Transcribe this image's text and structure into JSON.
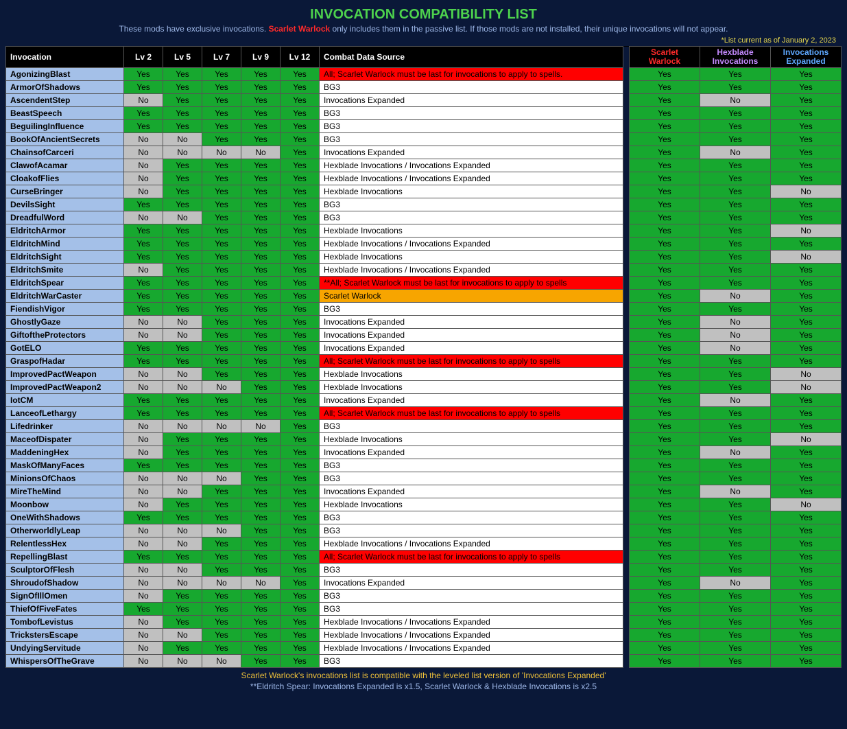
{
  "header": {
    "title": "INVOCATION COMPATIBILITY LIST",
    "subtitle_pre": "These mods have exclusive invocations. ",
    "subtitle_mod": "Scarlet Warlock",
    "subtitle_post": " only includes them in the passive list. If those mods are not installed, their unique invocations will not appear.",
    "asof": "*List current as of January 2, 2023"
  },
  "columns": {
    "name": "Invocation",
    "lv2": "Lv 2",
    "lv5": "Lv 5",
    "lv7": "Lv 7",
    "lv9": "Lv 9",
    "lv12": "Lv 12",
    "src": "Combat Data Source",
    "sw1": "Scarlet",
    "sw2": "Warlock",
    "hb1": "Hexblade",
    "hb2": "Invocations",
    "ie1": "Invocations",
    "ie2": "Expanded"
  },
  "rows": [
    {
      "name": "AgonizingBlast",
      "lv": [
        "Yes",
        "Yes",
        "Yes",
        "Yes",
        "Yes"
      ],
      "src": "All; Scarlet Warlock must be last for invocations to apply to spells.",
      "srcStyle": "red",
      "sw": "Yes",
      "hb": "Yes",
      "ie": "Yes"
    },
    {
      "name": "ArmorOfShadows",
      "lv": [
        "Yes",
        "Yes",
        "Yes",
        "Yes",
        "Yes"
      ],
      "src": "BG3",
      "srcStyle": "",
      "sw": "Yes",
      "hb": "Yes",
      "ie": "Yes"
    },
    {
      "name": "AscendentStep",
      "lv": [
        "No",
        "Yes",
        "Yes",
        "Yes",
        "Yes"
      ],
      "src": "Invocations Expanded",
      "srcStyle": "",
      "sw": "Yes",
      "hb": "No",
      "ie": "Yes"
    },
    {
      "name": "BeastSpeech",
      "lv": [
        "Yes",
        "Yes",
        "Yes",
        "Yes",
        "Yes"
      ],
      "src": "BG3",
      "srcStyle": "",
      "sw": "Yes",
      "hb": "Yes",
      "ie": "Yes"
    },
    {
      "name": "BeguilingInfluence",
      "lv": [
        "Yes",
        "Yes",
        "Yes",
        "Yes",
        "Yes"
      ],
      "src": "BG3",
      "srcStyle": "",
      "sw": "Yes",
      "hb": "Yes",
      "ie": "Yes"
    },
    {
      "name": "BookOfAncientSecrets",
      "lv": [
        "No",
        "No",
        "Yes",
        "Yes",
        "Yes"
      ],
      "src": "BG3",
      "srcStyle": "",
      "sw": "Yes",
      "hb": "Yes",
      "ie": "Yes"
    },
    {
      "name": "ChainsofCarceri",
      "lv": [
        "No",
        "No",
        "No",
        "No",
        "Yes"
      ],
      "src": "Invocations Expanded",
      "srcStyle": "",
      "sw": "Yes",
      "hb": "No",
      "ie": "Yes"
    },
    {
      "name": "ClawofAcamar",
      "lv": [
        "No",
        "Yes",
        "Yes",
        "Yes",
        "Yes"
      ],
      "src": "Hexblade Invocations / Invocations Expanded",
      "srcStyle": "",
      "sw": "Yes",
      "hb": "Yes",
      "ie": "Yes"
    },
    {
      "name": "CloakofFlies",
      "lv": [
        "No",
        "Yes",
        "Yes",
        "Yes",
        "Yes"
      ],
      "src": "Hexblade Invocations / Invocations Expanded",
      "srcStyle": "",
      "sw": "Yes",
      "hb": "Yes",
      "ie": "Yes"
    },
    {
      "name": "CurseBringer",
      "lv": [
        "No",
        "Yes",
        "Yes",
        "Yes",
        "Yes"
      ],
      "src": "Hexblade Invocations",
      "srcStyle": "",
      "sw": "Yes",
      "hb": "Yes",
      "ie": "No"
    },
    {
      "name": "DevilsSight",
      "lv": [
        "Yes",
        "Yes",
        "Yes",
        "Yes",
        "Yes"
      ],
      "src": "BG3",
      "srcStyle": "",
      "sw": "Yes",
      "hb": "Yes",
      "ie": "Yes"
    },
    {
      "name": "DreadfulWord",
      "lv": [
        "No",
        "No",
        "Yes",
        "Yes",
        "Yes"
      ],
      "src": "BG3",
      "srcStyle": "",
      "sw": "Yes",
      "hb": "Yes",
      "ie": "Yes"
    },
    {
      "name": "EldritchArmor",
      "lv": [
        "Yes",
        "Yes",
        "Yes",
        "Yes",
        "Yes"
      ],
      "src": "Hexblade Invocations",
      "srcStyle": "",
      "sw": "Yes",
      "hb": "Yes",
      "ie": "No"
    },
    {
      "name": "EldritchMind",
      "lv": [
        "Yes",
        "Yes",
        "Yes",
        "Yes",
        "Yes"
      ],
      "src": "Hexblade Invocations / Invocations Expanded",
      "srcStyle": "",
      "sw": "Yes",
      "hb": "Yes",
      "ie": "Yes"
    },
    {
      "name": "EldritchSight",
      "lv": [
        "Yes",
        "Yes",
        "Yes",
        "Yes",
        "Yes"
      ],
      "src": "Hexblade Invocations",
      "srcStyle": "",
      "sw": "Yes",
      "hb": "Yes",
      "ie": "No"
    },
    {
      "name": "EldritchSmite",
      "lv": [
        "No",
        "Yes",
        "Yes",
        "Yes",
        "Yes"
      ],
      "src": "Hexblade Invocations / Invocations Expanded",
      "srcStyle": "",
      "sw": "Yes",
      "hb": "Yes",
      "ie": "Yes"
    },
    {
      "name": "EldritchSpear",
      "lv": [
        "Yes",
        "Yes",
        "Yes",
        "Yes",
        "Yes"
      ],
      "src": "**All; Scarlet Warlock must be last for invocations to apply to spells",
      "srcStyle": "red",
      "sw": "Yes",
      "hb": "Yes",
      "ie": "Yes"
    },
    {
      "name": "EldritchWarCaster",
      "lv": [
        "Yes",
        "Yes",
        "Yes",
        "Yes",
        "Yes"
      ],
      "src": "Scarlet Warlock",
      "srcStyle": "orange",
      "sw": "Yes",
      "hb": "No",
      "ie": "Yes"
    },
    {
      "name": "FiendishVigor",
      "lv": [
        "Yes",
        "Yes",
        "Yes",
        "Yes",
        "Yes"
      ],
      "src": "BG3",
      "srcStyle": "",
      "sw": "Yes",
      "hb": "Yes",
      "ie": "Yes"
    },
    {
      "name": "GhostlyGaze",
      "lv": [
        "No",
        "No",
        "Yes",
        "Yes",
        "Yes"
      ],
      "src": "Invocations Expanded",
      "srcStyle": "",
      "sw": "Yes",
      "hb": "No",
      "ie": "Yes"
    },
    {
      "name": "GiftoftheProtectors",
      "lv": [
        "No",
        "No",
        "Yes",
        "Yes",
        "Yes"
      ],
      "src": "Invocations Expanded",
      "srcStyle": "",
      "sw": "Yes",
      "hb": "No",
      "ie": "Yes"
    },
    {
      "name": "GotELO",
      "lv": [
        "Yes",
        "Yes",
        "Yes",
        "Yes",
        "Yes"
      ],
      "src": "Invocations Expanded",
      "srcStyle": "",
      "sw": "Yes",
      "hb": "No",
      "ie": "Yes"
    },
    {
      "name": "GraspofHadar",
      "lv": [
        "Yes",
        "Yes",
        "Yes",
        "Yes",
        "Yes"
      ],
      "src": "All; Scarlet Warlock must be last for invocations to apply to spells",
      "srcStyle": "red",
      "sw": "Yes",
      "hb": "Yes",
      "ie": "Yes"
    },
    {
      "name": "ImprovedPactWeapon",
      "lv": [
        "No",
        "No",
        "Yes",
        "Yes",
        "Yes"
      ],
      "src": "Hexblade Invocations",
      "srcStyle": "",
      "sw": "Yes",
      "hb": "Yes",
      "ie": "No"
    },
    {
      "name": "ImprovedPactWeapon2",
      "lv": [
        "No",
        "No",
        "No",
        "Yes",
        "Yes"
      ],
      "src": "Hexblade Invocations",
      "srcStyle": "",
      "sw": "Yes",
      "hb": "Yes",
      "ie": "No"
    },
    {
      "name": "IotCM",
      "lv": [
        "Yes",
        "Yes",
        "Yes",
        "Yes",
        "Yes"
      ],
      "src": "Invocations Expanded",
      "srcStyle": "",
      "sw": "Yes",
      "hb": "No",
      "ie": "Yes"
    },
    {
      "name": "LanceofLethargy",
      "lv": [
        "Yes",
        "Yes",
        "Yes",
        "Yes",
        "Yes"
      ],
      "src": "All; Scarlet Warlock must be last for invocations to apply to spells",
      "srcStyle": "red",
      "sw": "Yes",
      "hb": "Yes",
      "ie": "Yes"
    },
    {
      "name": "Lifedrinker",
      "lv": [
        "No",
        "No",
        "No",
        "No",
        "Yes"
      ],
      "src": "BG3",
      "srcStyle": "",
      "sw": "Yes",
      "hb": "Yes",
      "ie": "Yes"
    },
    {
      "name": "MaceofDispater",
      "lv": [
        "No",
        "Yes",
        "Yes",
        "Yes",
        "Yes"
      ],
      "src": "Hexblade Invocations",
      "srcStyle": "",
      "sw": "Yes",
      "hb": "Yes",
      "ie": "No"
    },
    {
      "name": "MaddeningHex",
      "lv": [
        "No",
        "Yes",
        "Yes",
        "Yes",
        "Yes"
      ],
      "src": "Invocations Expanded",
      "srcStyle": "",
      "sw": "Yes",
      "hb": "No",
      "ie": "Yes"
    },
    {
      "name": "MaskOfManyFaces",
      "lv": [
        "Yes",
        "Yes",
        "Yes",
        "Yes",
        "Yes"
      ],
      "src": "BG3",
      "srcStyle": "",
      "sw": "Yes",
      "hb": "Yes",
      "ie": "Yes"
    },
    {
      "name": "MinionsOfChaos",
      "lv": [
        "No",
        "No",
        "No",
        "Yes",
        "Yes"
      ],
      "src": "BG3",
      "srcStyle": "",
      "sw": "Yes",
      "hb": "Yes",
      "ie": "Yes"
    },
    {
      "name": "MireTheMind",
      "lv": [
        "No",
        "No",
        "Yes",
        "Yes",
        "Yes"
      ],
      "src": "Invocations Expanded",
      "srcStyle": "",
      "sw": "Yes",
      "hb": "No",
      "ie": "Yes"
    },
    {
      "name": "Moonbow",
      "lv": [
        "No",
        "Yes",
        "Yes",
        "Yes",
        "Yes"
      ],
      "src": "Hexblade Invocations",
      "srcStyle": "",
      "sw": "Yes",
      "hb": "Yes",
      "ie": "No"
    },
    {
      "name": "OneWithShadows",
      "lv": [
        "Yes",
        "Yes",
        "Yes",
        "Yes",
        "Yes"
      ],
      "src": "BG3",
      "srcStyle": "",
      "sw": "Yes",
      "hb": "Yes",
      "ie": "Yes"
    },
    {
      "name": "OtherworldlyLeap",
      "lv": [
        "No",
        "No",
        "No",
        "Yes",
        "Yes"
      ],
      "src": "BG3",
      "srcStyle": "",
      "sw": "Yes",
      "hb": "Yes",
      "ie": "Yes"
    },
    {
      "name": "RelentlessHex",
      "lv": [
        "No",
        "No",
        "Yes",
        "Yes",
        "Yes"
      ],
      "src": "Hexblade Invocations / Invocations Expanded",
      "srcStyle": "",
      "sw": "Yes",
      "hb": "Yes",
      "ie": "Yes"
    },
    {
      "name": "RepellingBlast",
      "lv": [
        "Yes",
        "Yes",
        "Yes",
        "Yes",
        "Yes"
      ],
      "src": "All; Scarlet Warlock must be last for invocations to apply to spells",
      "srcStyle": "red",
      "sw": "Yes",
      "hb": "Yes",
      "ie": "Yes"
    },
    {
      "name": "SculptorOfFlesh",
      "lv": [
        "No",
        "No",
        "Yes",
        "Yes",
        "Yes"
      ],
      "src": "BG3",
      "srcStyle": "",
      "sw": "Yes",
      "hb": "Yes",
      "ie": "Yes"
    },
    {
      "name": "ShroudofShadow",
      "lv": [
        "No",
        "No",
        "No",
        "No",
        "Yes"
      ],
      "src": "Invocations Expanded",
      "srcStyle": "",
      "sw": "Yes",
      "hb": "No",
      "ie": "Yes"
    },
    {
      "name": "SignOfIllOmen",
      "lv": [
        "No",
        "Yes",
        "Yes",
        "Yes",
        "Yes"
      ],
      "src": "BG3",
      "srcStyle": "",
      "sw": "Yes",
      "hb": "Yes",
      "ie": "Yes"
    },
    {
      "name": "ThiefOfFiveFates",
      "lv": [
        "Yes",
        "Yes",
        "Yes",
        "Yes",
        "Yes"
      ],
      "src": "BG3",
      "srcStyle": "",
      "sw": "Yes",
      "hb": "Yes",
      "ie": "Yes"
    },
    {
      "name": "TombofLevistus",
      "lv": [
        "No",
        "Yes",
        "Yes",
        "Yes",
        "Yes"
      ],
      "src": "Hexblade Invocations / Invocations Expanded",
      "srcStyle": "",
      "sw": "Yes",
      "hb": "Yes",
      "ie": "Yes"
    },
    {
      "name": "TrickstersEscape",
      "lv": [
        "No",
        "No",
        "Yes",
        "Yes",
        "Yes"
      ],
      "src": "Hexblade Invocations / Invocations Expanded",
      "srcStyle": "",
      "sw": "Yes",
      "hb": "Yes",
      "ie": "Yes"
    },
    {
      "name": "UndyingServitude",
      "lv": [
        "No",
        "Yes",
        "Yes",
        "Yes",
        "Yes"
      ],
      "src": "Hexblade Invocations / Invocations Expanded",
      "srcStyle": "",
      "sw": "Yes",
      "hb": "Yes",
      "ie": "Yes"
    },
    {
      "name": "WhispersOfTheGrave",
      "lv": [
        "No",
        "No",
        "No",
        "Yes",
        "Yes"
      ],
      "src": "BG3",
      "srcStyle": "",
      "sw": "Yes",
      "hb": "Yes",
      "ie": "Yes"
    }
  ],
  "footer": {
    "line1": "Scarlet Warlock's invocations list is compatible with the leveled list version of 'Invocations Expanded'",
    "line2": "**Eldritch Spear: Invocations Expanded is x1.5, Scarlet Warlock & Hexblade Invocations is x2.5"
  }
}
